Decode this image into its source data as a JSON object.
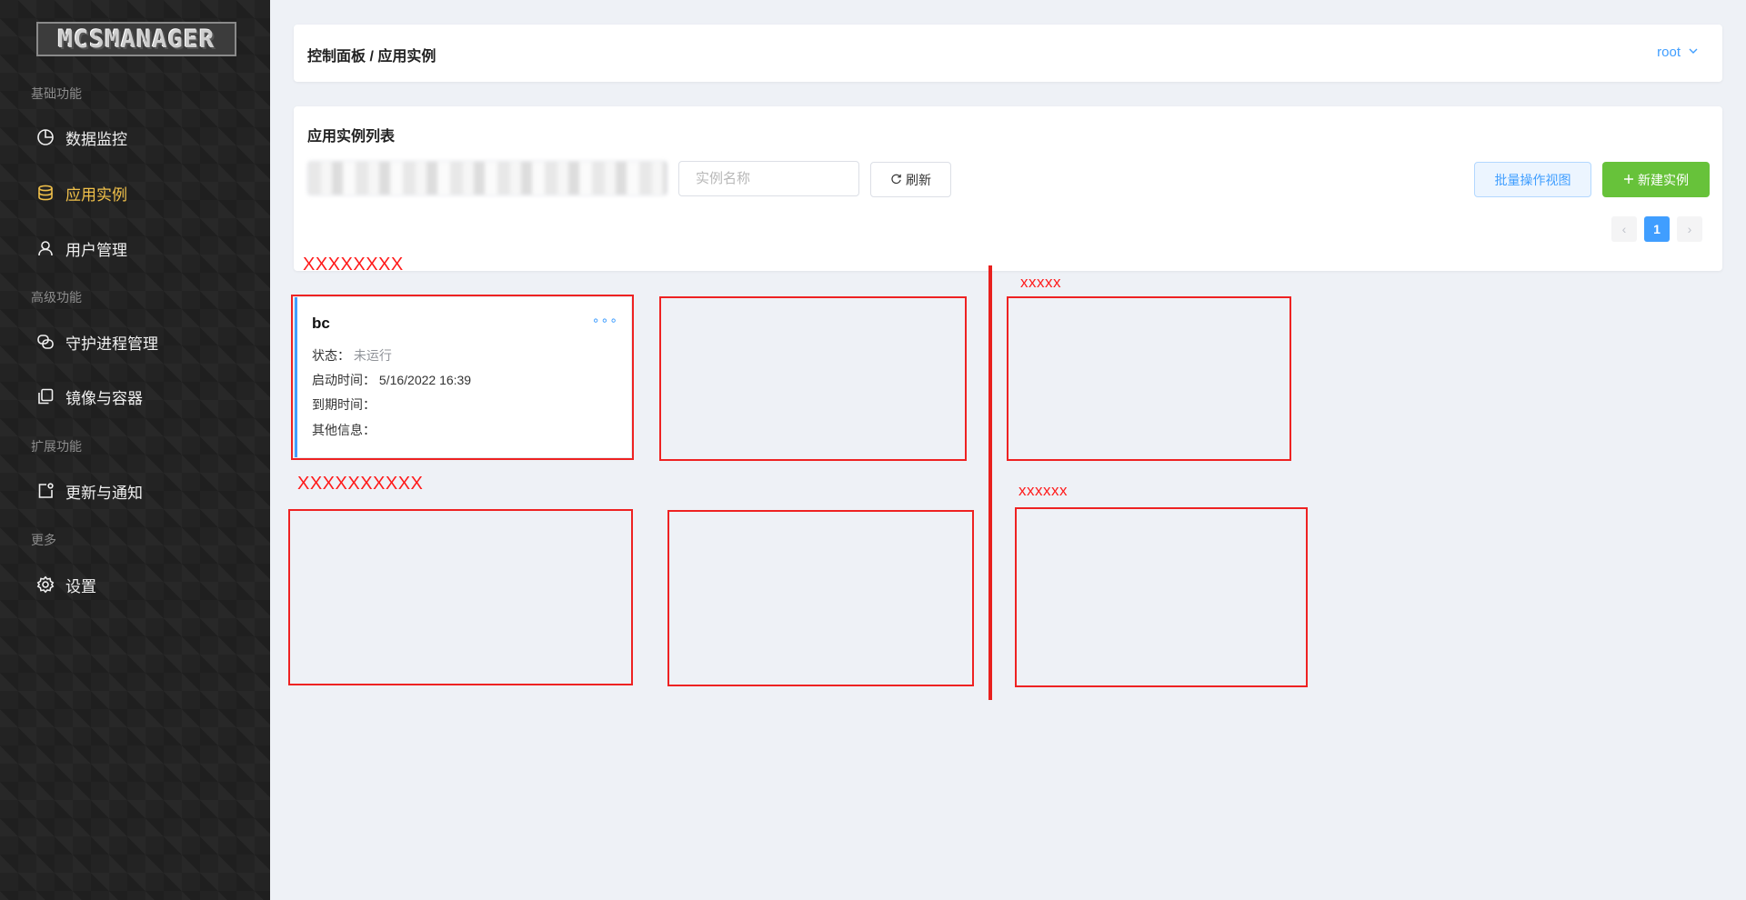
{
  "brand": {
    "logo_text": "MCSMANAGER"
  },
  "sidebar": {
    "sections": [
      {
        "title": "基础功能"
      },
      {
        "title": "高级功能"
      },
      {
        "title": "扩展功能"
      },
      {
        "title": "更多"
      }
    ],
    "items": [
      {
        "label": "数据监控",
        "icon": "pie-chart-icon"
      },
      {
        "label": "应用实例",
        "icon": "database-icon",
        "active": true
      },
      {
        "label": "用户管理",
        "icon": "user-icon"
      },
      {
        "label": "守护进程管理",
        "icon": "link-icon"
      },
      {
        "label": "镜像与容器",
        "icon": "copy-icon"
      },
      {
        "label": "更新与通知",
        "icon": "notification-icon"
      },
      {
        "label": "设置",
        "icon": "gear-icon"
      }
    ]
  },
  "header": {
    "breadcrumb": "控制面板 / 应用实例",
    "user": "root"
  },
  "list": {
    "title": "应用实例列表",
    "search_placeholder": "实例名称",
    "refresh_label": "刷新",
    "batch_label": "批量操作视图",
    "new_label": "新建实例",
    "pagination": {
      "prev": "‹",
      "current": "1",
      "next": "›"
    }
  },
  "annotations": {
    "label_top_left": "XXXXXXXX",
    "label_bottom_left": "XXXXXXXXXX",
    "label_top_right": "xxxxx",
    "label_bottom_right": "xxxxxx",
    "color": "#ee2222"
  },
  "instance": {
    "name": "bc",
    "more": "∘∘∘",
    "rows": [
      {
        "label": "状态：",
        "value": "未运行"
      },
      {
        "label": "启动时间：",
        "value": "5/16/2022 16:39"
      },
      {
        "label": "到期时间：",
        "value": ""
      },
      {
        "label": "其他信息：",
        "value": ""
      }
    ]
  },
  "colors": {
    "accent": "#409eff",
    "active_menu": "#f0c04a",
    "success": "#67c23a",
    "annotation_red": "#ee2222"
  }
}
